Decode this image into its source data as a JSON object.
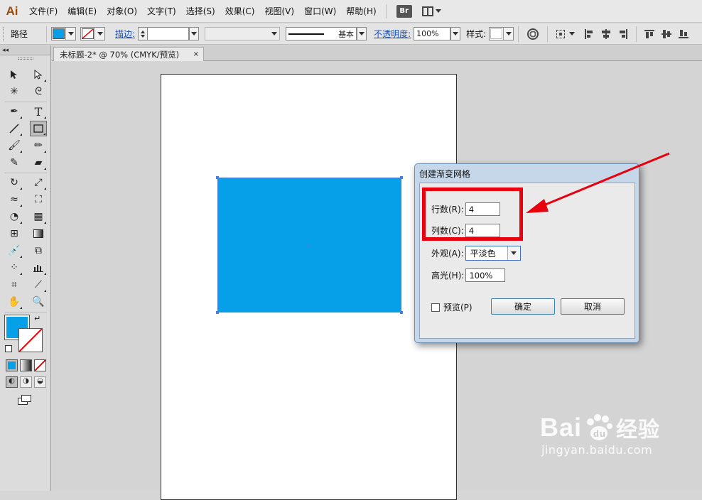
{
  "app": {
    "logo": "Ai"
  },
  "menu": [
    {
      "label": "文件(F)"
    },
    {
      "label": "编辑(E)"
    },
    {
      "label": "对象(O)"
    },
    {
      "label": "文字(T)"
    },
    {
      "label": "选择(S)"
    },
    {
      "label": "效果(C)"
    },
    {
      "label": "视图(V)"
    },
    {
      "label": "窗口(W)"
    },
    {
      "label": "帮助(H)"
    }
  ],
  "menu_extra": {
    "bridge": "Br"
  },
  "control": {
    "object_type": "路径",
    "fill_color": "#06a0e8",
    "stroke_label": "描边:",
    "stroke_style_label": "基本",
    "opacity_label": "不透明度:",
    "opacity_value": "100%",
    "style_label": "样式:"
  },
  "document": {
    "tab_title": "未标题-2* @ 70% (CMYK/预览)",
    "close": "×"
  },
  "shape": {
    "fill": "#06a0e8"
  },
  "colors": {
    "fill": "#06a0e8",
    "highlight": "#e8000f"
  },
  "dialog": {
    "title": "创建渐变网格",
    "rows_label": "行数(R):",
    "rows_value": "4",
    "cols_label": "列数(C):",
    "cols_value": "4",
    "appearance_label": "外观(A):",
    "appearance_value": "平淡色",
    "highlight_label": "高光(H):",
    "highlight_value": "100%",
    "preview_label": "预览(P)",
    "ok_label": "确定",
    "cancel_label": "取消"
  },
  "watermark": {
    "brand": "Bai",
    "brand_du": "du",
    "brand_cn": "经验",
    "url": "jingyan.baidu.com"
  }
}
